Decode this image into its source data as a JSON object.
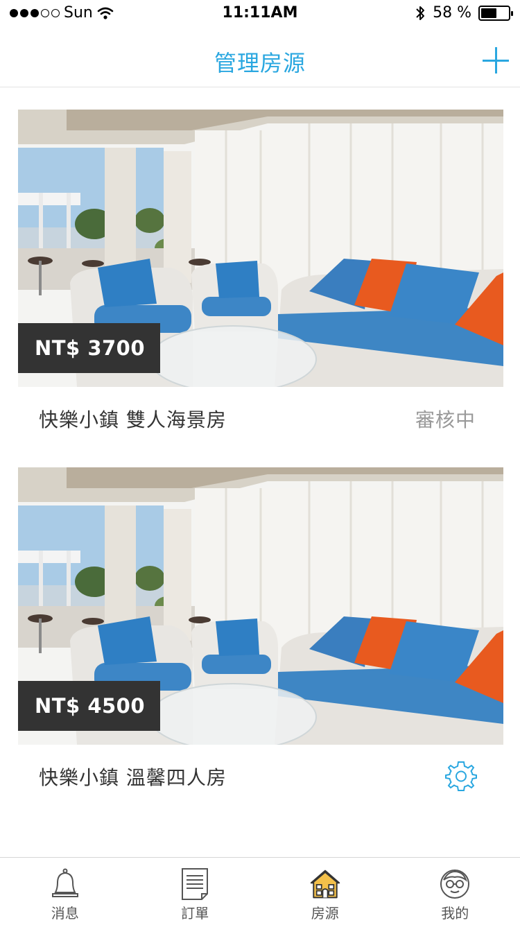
{
  "status_bar": {
    "carrier": "Sun",
    "time": "11:11AM",
    "battery_text": "58 %",
    "battery_level": 0.58
  },
  "nav": {
    "title": "管理房源"
  },
  "listings": [
    {
      "price": "NT$ 3700",
      "name": "快樂小鎮 雙人海景房",
      "status": "審核中"
    },
    {
      "price": "NT$ 4500",
      "name": "快樂小鎮 溫馨四人房",
      "status_icon": "gear-icon"
    }
  ],
  "tabs": [
    {
      "label": "消息",
      "icon": "bell-icon"
    },
    {
      "label": "訂單",
      "icon": "document-icon"
    },
    {
      "label": "房源",
      "icon": "house-icon",
      "active": true
    },
    {
      "label": "我的",
      "icon": "profile-icon"
    }
  ],
  "colors": {
    "accent": "#2aa7e0",
    "price_tag_bg": "#333333",
    "status_text": "#999999"
  }
}
